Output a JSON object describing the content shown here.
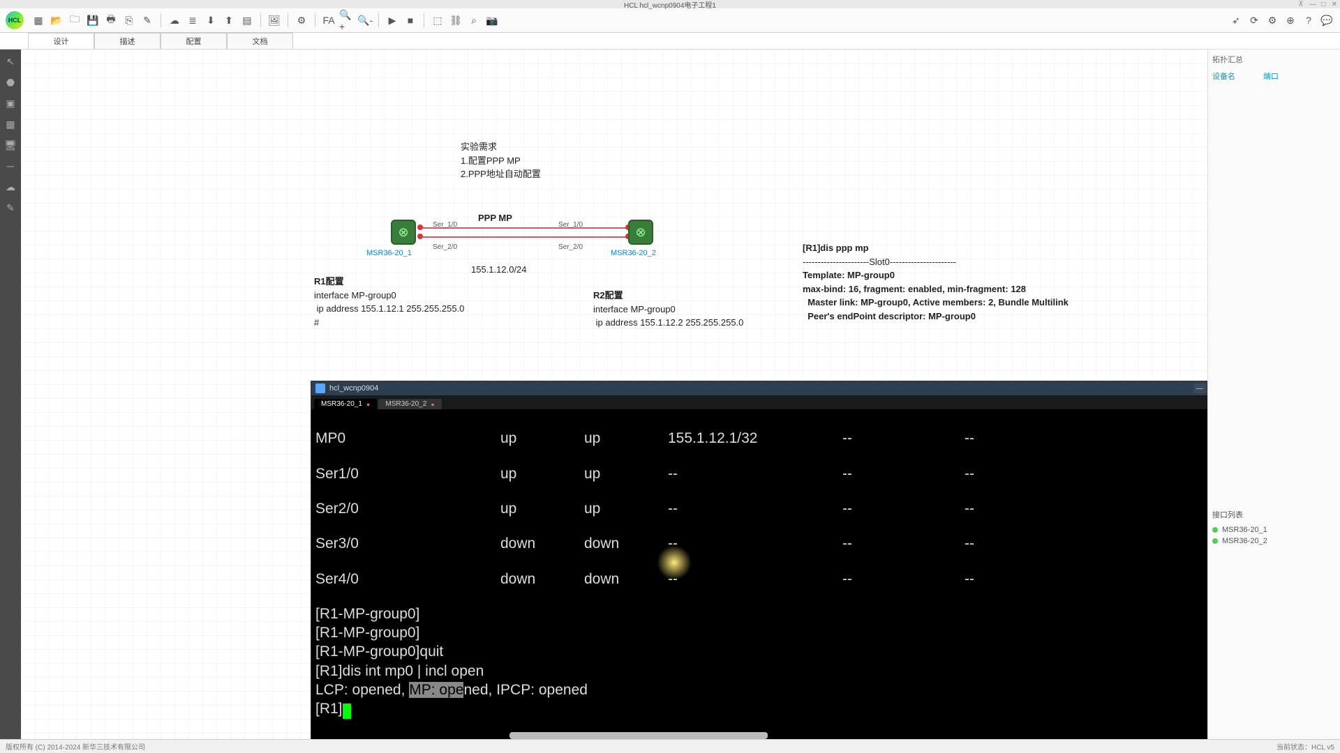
{
  "app": {
    "title": "HCL  hcl_wcnp0904电子工程1"
  },
  "tabs": [
    "设计",
    "描述",
    "配置",
    "文档"
  ],
  "topo": {
    "req_title": "实验需求",
    "req1": "1.配置PPP MP",
    "req2": "2.PPP地址自动配置",
    "link_title": "PPP MP",
    "subnet": "155.1.12.0/24",
    "r1_name": "MSR36-20_1",
    "r2_name": "MSR36-20_2",
    "ser10": "Ser_1/0",
    "ser20": "Ser_2/0",
    "ser10b": "Ser_1/0",
    "ser20b": "Ser_2/0",
    "r1_cfg_title": "R1配置",
    "r1_cfg_l1": "interface MP-group0",
    "r1_cfg_l2": " ip address 155.1.12.1 255.255.255.0",
    "r2_cfg_title": "R2配置",
    "r2_cfg_l1": "interface MP-group0",
    "r2_cfg_l2": " ip address 155.1.12.2 255.255.255.0",
    "info_l1": "[R1]dis ppp mp",
    "info_l2": "----------------------Slot0----------------------",
    "info_l3": "Template: MP-group0",
    "info_l4": "max-bind: 16, fragment: enabled, min-fragment: 128",
    "info_l5": "  Master link: MP-group0, Active members: 2, Bundle Multilink",
    "info_l6": "  Peer's endPoint descriptor: MP-group0"
  },
  "terminal": {
    "win_title": "hcl_wcnp0904",
    "tab1": "MSR36-20_1",
    "tab2": "MSR36-20_2",
    "rows": [
      {
        "i": "MP0",
        "s": "up",
        "p": "up",
        "ip": "155.1.12.1/32",
        "d": "--",
        "e": "--"
      },
      {
        "i": "Ser1/0",
        "s": "up",
        "p": "up",
        "ip": "--",
        "d": "--",
        "e": "--"
      },
      {
        "i": "Ser2/0",
        "s": "up",
        "p": "up",
        "ip": "--",
        "d": "--",
        "e": "--"
      },
      {
        "i": "Ser3/0",
        "s": "down",
        "p": "down",
        "ip": "--",
        "d": "--",
        "e": "--"
      },
      {
        "i": "Ser4/0",
        "s": "down",
        "p": "down",
        "ip": "--",
        "d": "--",
        "e": "--"
      }
    ],
    "l6": "[R1-MP-group0]",
    "l7": "[R1-MP-group0]",
    "l8": "[R1-MP-group0]quit",
    "l9": "[R1]dis int mp0 | incl open",
    "l10a": "LCP: opened, ",
    "l10b": "MP: ope",
    "l10c": "ned, IPCP: opened",
    "l11": "[R1]"
  },
  "right": {
    "head": "拓扑汇总",
    "col1": "设备名",
    "col2": "端口",
    "sec": "接口列表",
    "d1": "MSR36-20_1",
    "d2": "MSR36-20_2"
  },
  "footer": {
    "left": "版权所有 (C) 2014-2024 新华三技术有限公司",
    "right": "当前状态：HCL v5"
  }
}
